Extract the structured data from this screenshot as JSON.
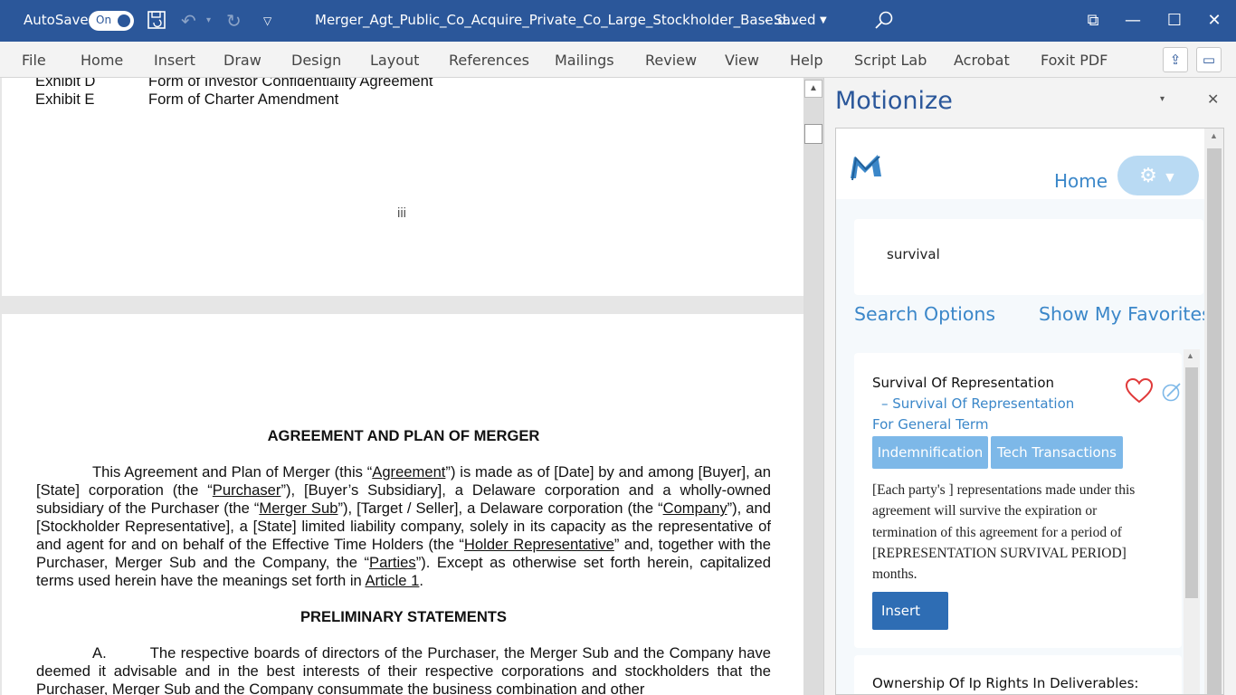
{
  "titlebar": {
    "autosave_label": "AutoSave",
    "autosave_state": "On",
    "filename": "Merger_Agt_Public_Co_Acquire_Private_Co_Large_Stockholder_Base.d...",
    "saved": "-  Saved"
  },
  "ribbon": {
    "tabs": [
      "File",
      "Home",
      "Insert",
      "Draw",
      "Design",
      "Layout",
      "References",
      "Mailings",
      "Review",
      "View",
      "Help",
      "Script Lab",
      "Acrobat",
      "Foxit PDF"
    ]
  },
  "document": {
    "exhibits": [
      {
        "label": "Exhibit D",
        "title": "Form of Investor Confidentiality Agreement"
      },
      {
        "label": "Exhibit E",
        "title": "Form of Charter Amendment"
      }
    ],
    "page_number": "iii",
    "heading": "AGREEMENT AND PLAN OF MERGER",
    "para1": {
      "t1": "This Agreement and Plan of Merger (this “",
      "u1": "Agreement",
      "t2": "”) is made as of [Date] by and among [Buyer], an [State] corporation (the “",
      "u2": "Purchaser",
      "t3": "”), [Buyer’s Subsidiary], a Delaware corporation and a wholly-owned subsidiary of the Purchaser (the “",
      "u3": "Merger Sub",
      "t4": "”), [Target / Seller], a Delaware corporation (the “",
      "u4": "Company",
      "t5": "”), and [Stockholder Representative], a [State] limited liability company, solely in its capacity as the representative of and agent for and on behalf of the Effective Time Holders (the “",
      "u5": "Holder Representative",
      "t6": "” and, together with the Purchaser, Merger Sub and the Company, the “",
      "u6": "Parties",
      "t7": "”).  Except as otherwise set forth herein, capitalized terms used herein have the meanings set forth in ",
      "u7": "Article 1",
      "t8": "."
    },
    "heading2": "PRELIMINARY STATEMENTS",
    "para2": "A.         The respective boards of directors of the Purchaser, the Merger Sub and the Company have deemed it advisable and in the best interests of their respective corporations and stockholders that the Purchaser, Merger Sub and the Company consummate the business combination and other"
  },
  "pane": {
    "title": "Motionize",
    "home": "Home",
    "search_value": "survival",
    "search_options": "Search Options",
    "show_favorites": "Show My Favorites",
    "card": {
      "title": "Survival Of Representation",
      "subtitle": "– Survival Of Representation",
      "for_term": "For General Term",
      "tags": [
        "Indemnification",
        "Tech Transactions"
      ],
      "body": "[Each party's ] representations made under this agreement will survive the expiration or termination of this agreement for a period of [REPRESENTATION SURVIVAL PERIOD] months.",
      "insert": "Insert"
    },
    "card2_title": "Ownership Of Ip Rights In Deliverables:"
  },
  "colors": {
    "word_blue": "#2b579a",
    "motionize_blue": "#3b87c9",
    "tag_blue": "#7db8e8",
    "heart_red": "#e03a3a"
  }
}
